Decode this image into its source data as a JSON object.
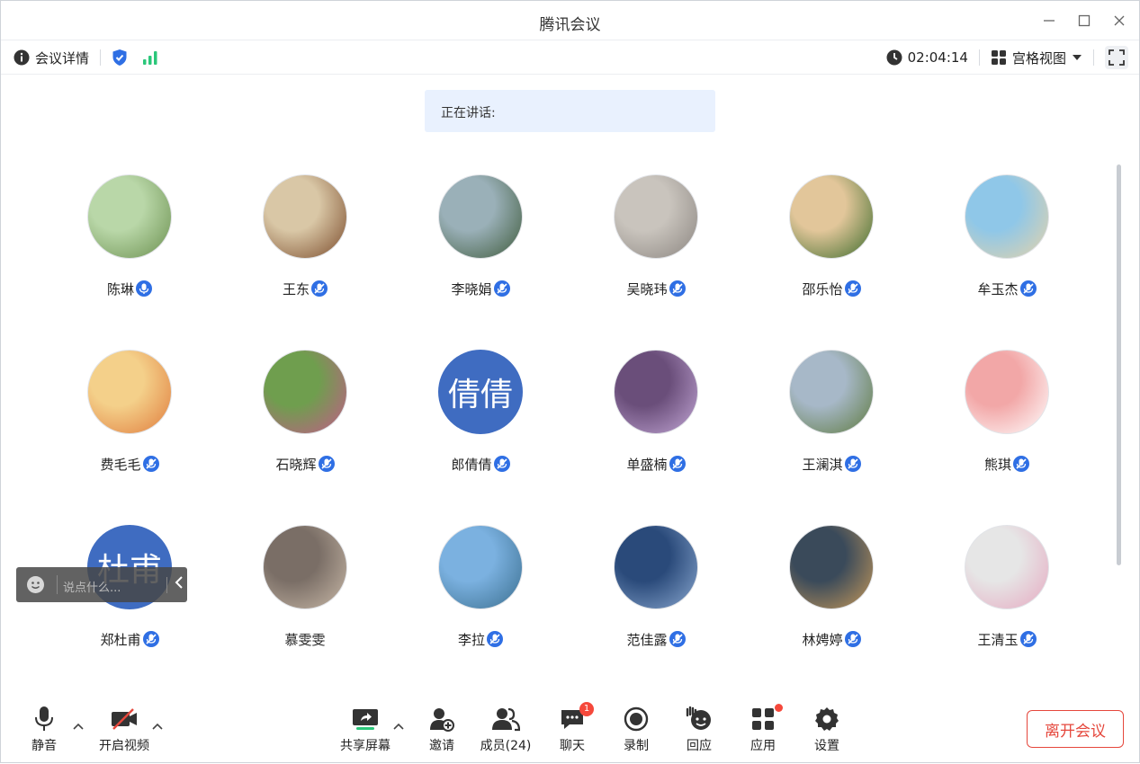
{
  "window": {
    "title": "腾讯会议"
  },
  "infobar": {
    "details_label": "会议详情",
    "time": "02:04:14",
    "view_label": "宫格视图"
  },
  "speaking": {
    "label": "正在讲话:"
  },
  "participants": [
    {
      "name": "陈琳",
      "avatar": "photo",
      "mic": "active"
    },
    {
      "name": "王东",
      "avatar": "photo",
      "mic": "muted"
    },
    {
      "name": "李晓娟",
      "avatar": "photo",
      "mic": "muted"
    },
    {
      "name": "吴晓玮",
      "avatar": "photo",
      "mic": "muted"
    },
    {
      "name": "邵乐怡",
      "avatar": "photo",
      "mic": "muted"
    },
    {
      "name": "牟玉杰",
      "avatar": "photo",
      "mic": "muted"
    },
    {
      "name": "费毛毛",
      "avatar": "photo",
      "mic": "muted"
    },
    {
      "name": "石晓辉",
      "avatar": "photo",
      "mic": "muted"
    },
    {
      "name": "郎倩倩",
      "avatar": "text",
      "avatar_text": "倩倩",
      "mic": "muted"
    },
    {
      "name": "单盛楠",
      "avatar": "photo",
      "mic": "muted"
    },
    {
      "name": "王澜淇",
      "avatar": "photo",
      "mic": "muted"
    },
    {
      "name": "熊琪",
      "avatar": "photo",
      "mic": "muted"
    },
    {
      "name": "郑杜甫",
      "avatar": "text",
      "avatar_text": "杜甫",
      "mic": "muted"
    },
    {
      "name": "慕雯雯",
      "avatar": "photo",
      "mic": "none"
    },
    {
      "name": "李拉",
      "avatar": "photo",
      "mic": "muted"
    },
    {
      "name": "范佳露",
      "avatar": "photo",
      "mic": "muted"
    },
    {
      "name": "林娉婷",
      "avatar": "photo",
      "mic": "muted"
    },
    {
      "name": "王清玉",
      "avatar": "photo",
      "mic": "muted"
    }
  ],
  "chat": {
    "placeholder": "说点什么..."
  },
  "toolbar": {
    "mute_label": "静音",
    "video_label": "开启视频",
    "share_label": "共享屏幕",
    "invite_label": "邀请",
    "members_label": "成员(24)",
    "chat_label": "聊天",
    "chat_badge": "1",
    "record_label": "录制",
    "react_label": "回应",
    "apps_label": "应用",
    "settings_label": "设置",
    "leave_label": "离开会议"
  },
  "colors": {
    "accent": "#2f6fe4",
    "active_mic": "#2f6fe4",
    "leave": "#e5473c",
    "speaking_bg": "#e9f1fe",
    "signal": "#2bc77a"
  }
}
